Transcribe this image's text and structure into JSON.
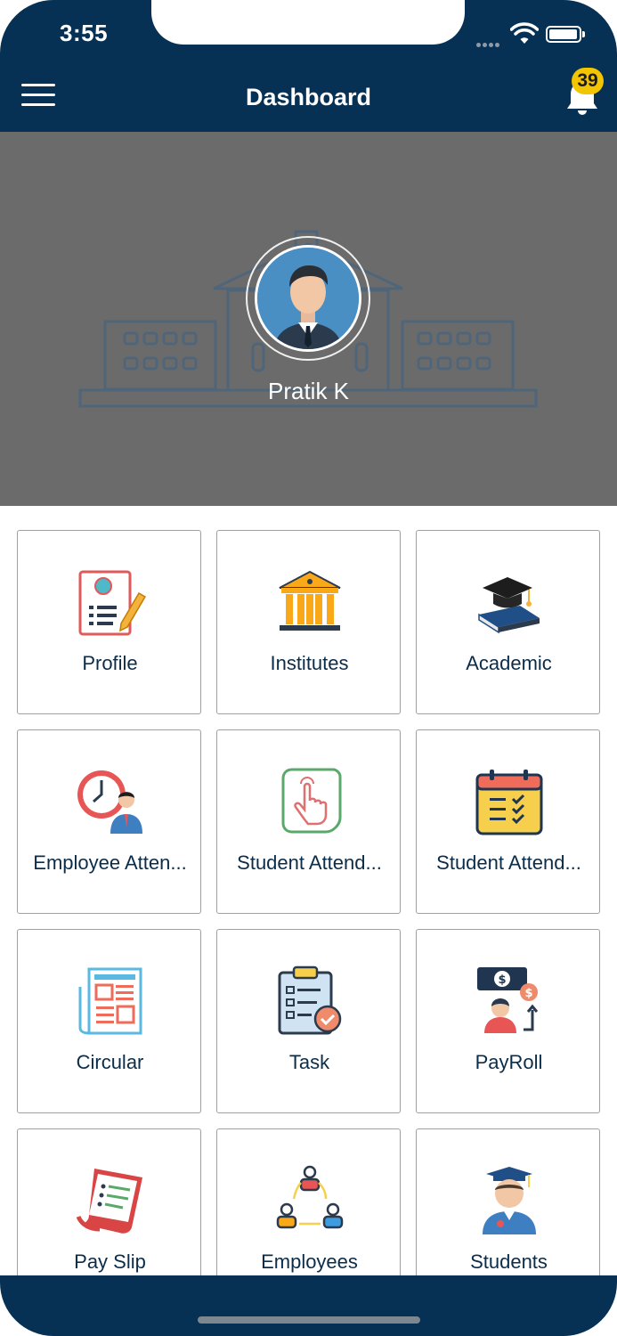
{
  "status_bar": {
    "time": "3:55"
  },
  "header": {
    "title": "Dashboard",
    "notification_count": "39"
  },
  "profile": {
    "name": "Pratik K"
  },
  "tiles": [
    {
      "label": "Profile",
      "icon": "profile-icon"
    },
    {
      "label": "Institutes",
      "icon": "institute-icon"
    },
    {
      "label": "Academic",
      "icon": "academic-icon"
    },
    {
      "label": "Employee Atten...",
      "icon": "employee-attendance-icon"
    },
    {
      "label": "Student Attend...",
      "icon": "student-attendance-touch-icon"
    },
    {
      "label": "Student Attend...",
      "icon": "student-attendance-calendar-icon"
    },
    {
      "label": "Circular",
      "icon": "circular-icon"
    },
    {
      "label": "Task",
      "icon": "task-icon"
    },
    {
      "label": "PayRoll",
      "icon": "payroll-icon"
    },
    {
      "label": "Pay Slip",
      "icon": "pay-slip-icon"
    },
    {
      "label": "Employees",
      "icon": "employees-icon"
    },
    {
      "label": "Students",
      "icon": "students-icon"
    }
  ],
  "colors": {
    "navy": "#063154",
    "badge": "#f3c400",
    "hero": "#6b6b6b",
    "label": "#0b2d4a"
  }
}
